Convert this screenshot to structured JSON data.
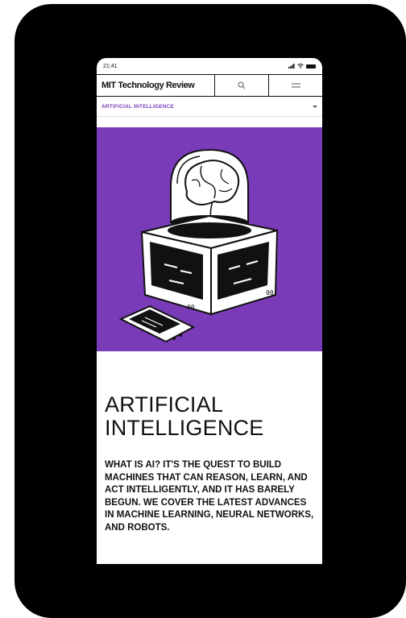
{
  "status_bar": {
    "time": "21:41"
  },
  "header": {
    "logo": "MIT Technology Review"
  },
  "section_nav": {
    "label": "ARTIFICIAL INTELLIGENCE"
  },
  "page": {
    "title": "ARTIFICIAL INTELLIGENCE",
    "description": "WHAT IS AI? IT'S THE QUEST TO BUILD MACHINES THAT CAN REASON, LEARN, AND ACT INTELLIGENTLY, AND IT HAS BARELY BEGUN. WE COVER THE LATEST ADVANCES IN MACHINE LEARNING, NEURAL NETWORKS, AND ROBOTS."
  },
  "colors": {
    "accent": "#7a3bb8",
    "frame": "#000000"
  },
  "icons": [
    "search-icon",
    "menu-icon",
    "chevron-down-icon",
    "brain-illustration"
  ]
}
